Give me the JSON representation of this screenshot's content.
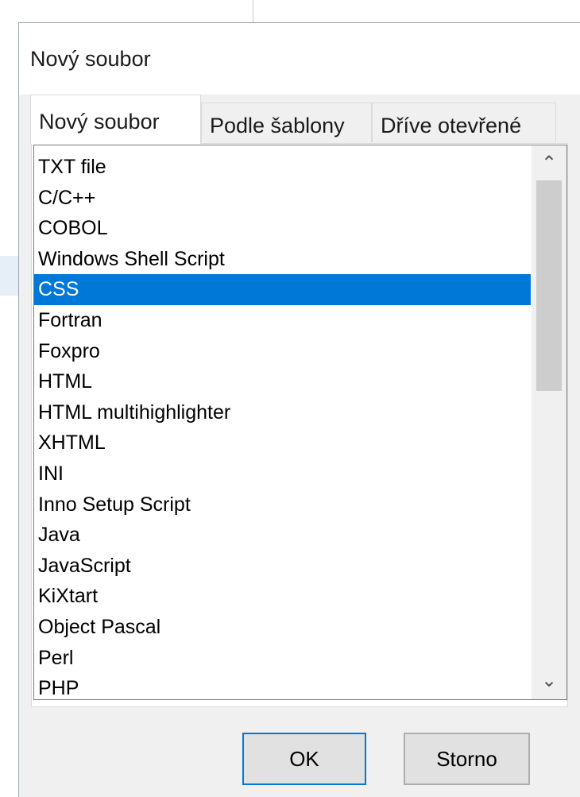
{
  "dialog": {
    "title": "Nový soubor",
    "tabs": [
      {
        "label": "Nový soubor",
        "active": true
      },
      {
        "label": "Podle šablony",
        "active": false
      },
      {
        "label": "Dříve otevřené",
        "active": false
      }
    ],
    "list": {
      "selected": "CSS",
      "items": [
        "TXT file",
        "C/C++",
        "COBOL",
        "Windows Shell Script",
        "CSS",
        "Fortran",
        "Foxpro",
        "HTML",
        "HTML multihighlighter",
        "XHTML",
        "INI",
        "Inno Setup Script",
        "Java",
        "JavaScript",
        "KiXtart",
        "Object Pascal",
        "Perl",
        "PHP"
      ]
    },
    "buttons": {
      "ok": "OK",
      "cancel": "Storno"
    }
  }
}
